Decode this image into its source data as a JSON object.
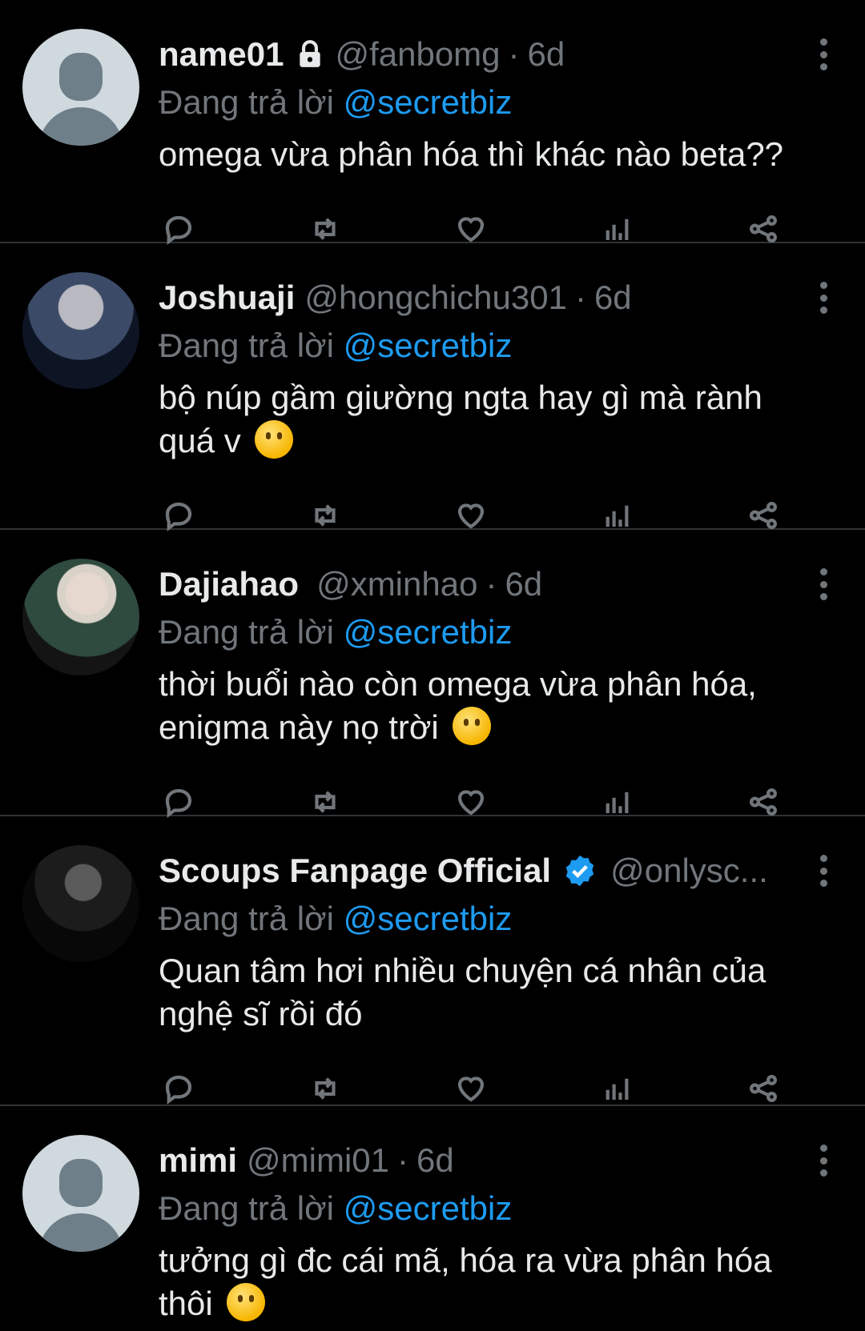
{
  "colors": {
    "background": "#000000",
    "text": "#e7e9ea",
    "muted": "#71767b",
    "accent": "#1d9bf0"
  },
  "tweets": [
    {
      "name": "name01",
      "handle": "@fanbomg",
      "separator": "·",
      "time": "6d",
      "reply_prefix": "Đang trả lời",
      "reply_to": "@secretbiz",
      "text": "omega vừa phân hóa thì khác nào beta??",
      "avatar": "default",
      "locked": true,
      "verified": false,
      "emoji": false
    },
    {
      "name": "Joshuaji",
      "handle": "@hongchichu301",
      "separator": "·",
      "time": "6d",
      "reply_prefix": "Đang trả lời",
      "reply_to": "@secretbiz",
      "text": "bộ núp gầm giường ngta hay gì mà rành quá v",
      "avatar": "photo",
      "locked": false,
      "verified": false,
      "emoji": true
    },
    {
      "name": "Dajiahao",
      "handle": "@xminhao",
      "separator": "·",
      "time": "6d",
      "reply_prefix": "Đang trả lời",
      "reply_to": "@secretbiz",
      "text": "thời buổi nào còn omega vừa phân hóa, enigma này nọ trời",
      "avatar": "photo",
      "locked": false,
      "verified": false,
      "emoji": true
    },
    {
      "name": "Scoups Fanpage Official",
      "handle": "@onlysc...",
      "separator": "",
      "time": "",
      "reply_prefix": "Đang trả lời",
      "reply_to": "@secretbiz",
      "text": "Quan tâm hơi nhiều chuyện cá nhân của nghệ sĩ rồi đó",
      "avatar": "photo",
      "locked": false,
      "verified": true,
      "emoji": false
    },
    {
      "name": "mimi",
      "handle": "@mimi01",
      "separator": "·",
      "time": "6d",
      "reply_prefix": "Đang trả lời",
      "reply_to": "@secretbiz",
      "text": "tưởng gì đc cái mã, hóa ra vừa phân hóa thôi",
      "avatar": "default",
      "locked": false,
      "verified": false,
      "emoji": true
    }
  ],
  "actions": [
    {
      "icon": "reply-icon"
    },
    {
      "icon": "retweet-icon"
    },
    {
      "icon": "like-icon"
    },
    {
      "icon": "views-icon"
    },
    {
      "icon": "share-icon"
    }
  ]
}
